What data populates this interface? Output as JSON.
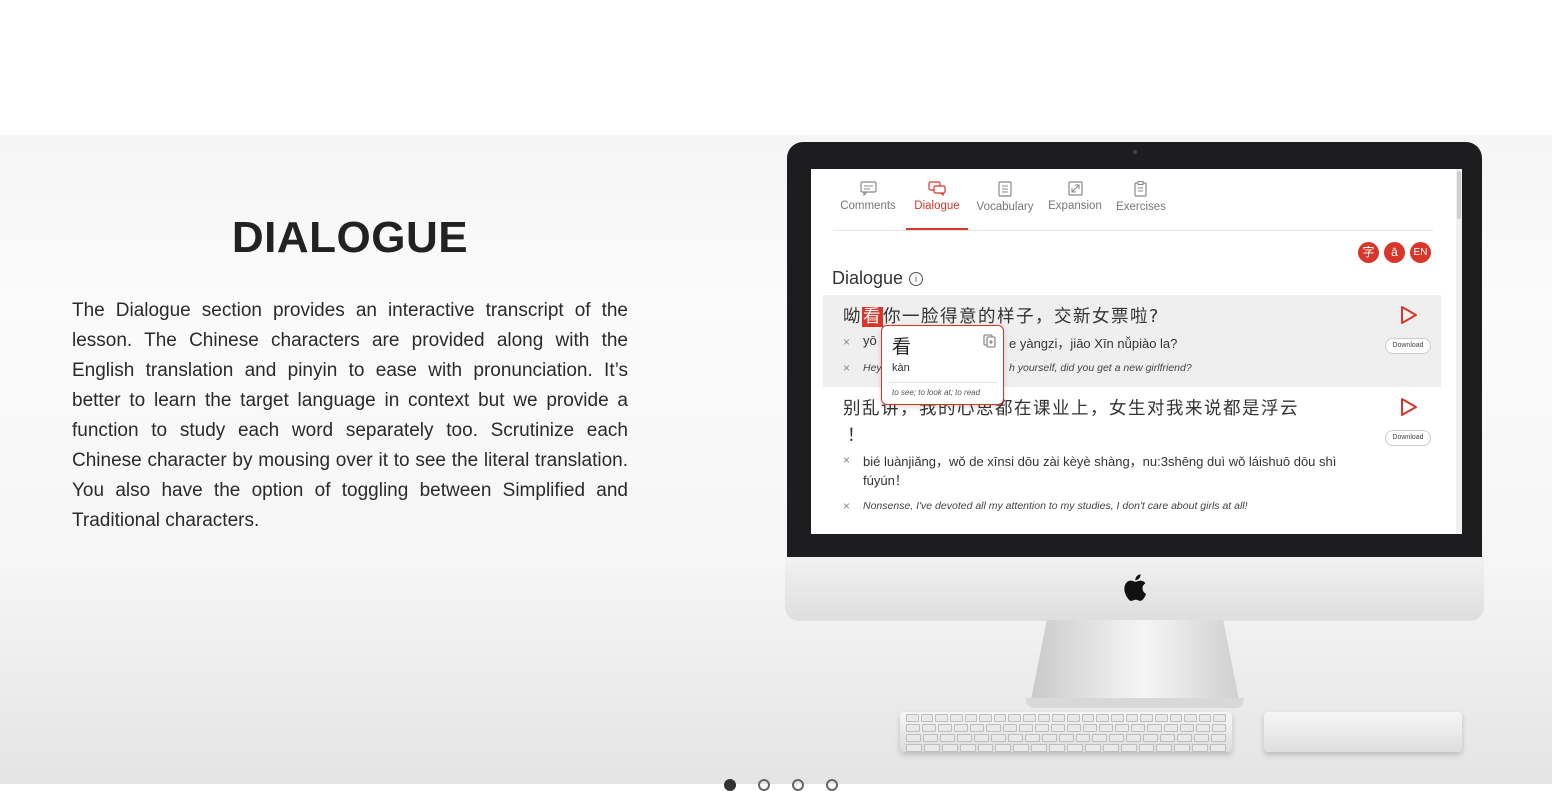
{
  "section": {
    "title": "DIALOGUE",
    "description": "The Dialogue section provides an interactive transcript of the lesson. The Chinese characters are provided along with the English translation and pinyin to ease with pronunciation. It’s better to learn the target language in context but we provide a function to study each word separately too. Scrutinize each Chinese character by mousing over it to see the literal translation. You also have the option of toggling between Simplified and Traditional characters."
  },
  "app": {
    "tabs": [
      {
        "label": "Comments",
        "icon": "comment-icon",
        "active": false
      },
      {
        "label": "Dialogue",
        "icon": "dialogue-icon",
        "active": true
      },
      {
        "label": "Vocabulary",
        "icon": "vocabulary-icon",
        "active": false
      },
      {
        "label": "Expansion",
        "icon": "expansion-icon",
        "active": false
      },
      {
        "label": "Exercises",
        "icon": "exercises-icon",
        "active": false
      }
    ],
    "mode_buttons": [
      "字",
      "ā",
      "EN"
    ],
    "heading": "Dialogue",
    "lines": [
      {
        "zh_before": "呦",
        "zh_highlight": "看",
        "zh_after": "你一脸得意的样子，交新女票啦?",
        "pinyin_start": "yō",
        "pinyin_end": "e yàngzi，jiāo Xīn nǚpiào la?",
        "en_start": "Hey",
        "en_end": "h yourself, did you get a new girlfriend?",
        "download": "Download"
      },
      {
        "zh": "别乱讲，我的心思都在课业上，女生对我来说都是浮云",
        "zh_cont": "！",
        "pinyin": "bié luànjiǎng，wǒ de xīnsi dōu zài kèyè shàng，nu:3shēng duì wǒ láishuō dōu shì",
        "pinyin_cont": "fúyún！",
        "en": "Nonsense, I've devoted all my attention to my studies, I don't care about girls at all!",
        "download": "Download"
      }
    ],
    "popup": {
      "character": "看",
      "pinyin": "kàn",
      "definition": "to see; to look at; to read"
    }
  },
  "colors": {
    "accent": "#d9362b",
    "text": "#222222"
  },
  "carousel": {
    "total": 4,
    "active_index": 0
  }
}
